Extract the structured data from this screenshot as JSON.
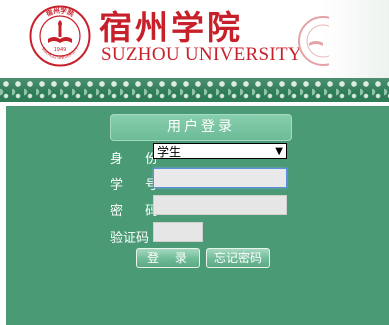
{
  "header": {
    "school_name_cn": "宿州学院",
    "school_name_en": "SUZHOU UNIVERSITY",
    "seal": {
      "top_text": "宿州学院",
      "year": "1949",
      "bottom_text": "SUZHOU UNIVERSITY"
    }
  },
  "login": {
    "title": "用户登录",
    "labels": {
      "identity": "身 份",
      "student_id": "学 号",
      "password": "密 码",
      "captcha": "验证码"
    },
    "role_select": {
      "value": "学生",
      "arrow_icon": "triangle-down-icon"
    },
    "inputs": {
      "student_id_value": "",
      "password_value": "",
      "captcha_value": ""
    },
    "buttons": {
      "login": "登 录",
      "forgot_password": "忘记密码"
    }
  },
  "colors": {
    "brand_red": "#c8202a",
    "panel_green": "#4a9a75",
    "strip_green": "#2f7c59",
    "title_green": "#7cc7a5"
  }
}
